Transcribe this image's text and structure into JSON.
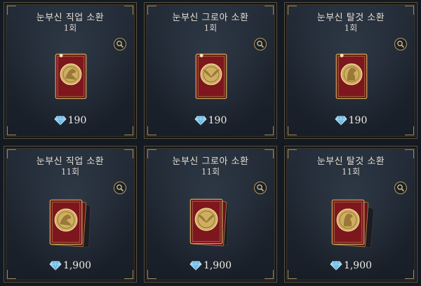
{
  "cards": [
    {
      "title": "눈부신 직업 소환",
      "count": "1회",
      "price": "190",
      "stack": false,
      "emblem": "bird"
    },
    {
      "title": "눈부신 그로아 소환",
      "count": "1회",
      "price": "190",
      "stack": false,
      "emblem": "wings"
    },
    {
      "title": "눈부신 탈것 소환",
      "count": "1회",
      "price": "190",
      "stack": false,
      "emblem": "horse"
    },
    {
      "title": "눈부신 직업 소환",
      "count": "11회",
      "price": "1,900",
      "stack": true,
      "emblem": "bird"
    },
    {
      "title": "눈부신 그로아 소환",
      "count": "11회",
      "price": "1,900",
      "stack": true,
      "emblem": "wings"
    },
    {
      "title": "눈부신 탈것 소환",
      "count": "11회",
      "price": "1,900",
      "stack": true,
      "emblem": "horse"
    }
  ],
  "icons": {
    "zoom": "magnifier-icon",
    "currency": "diamond-gem-icon"
  },
  "colors": {
    "card_red": "#8e1c22",
    "gold": "#d4b36a",
    "gem_blue": "#7fc8f0"
  }
}
